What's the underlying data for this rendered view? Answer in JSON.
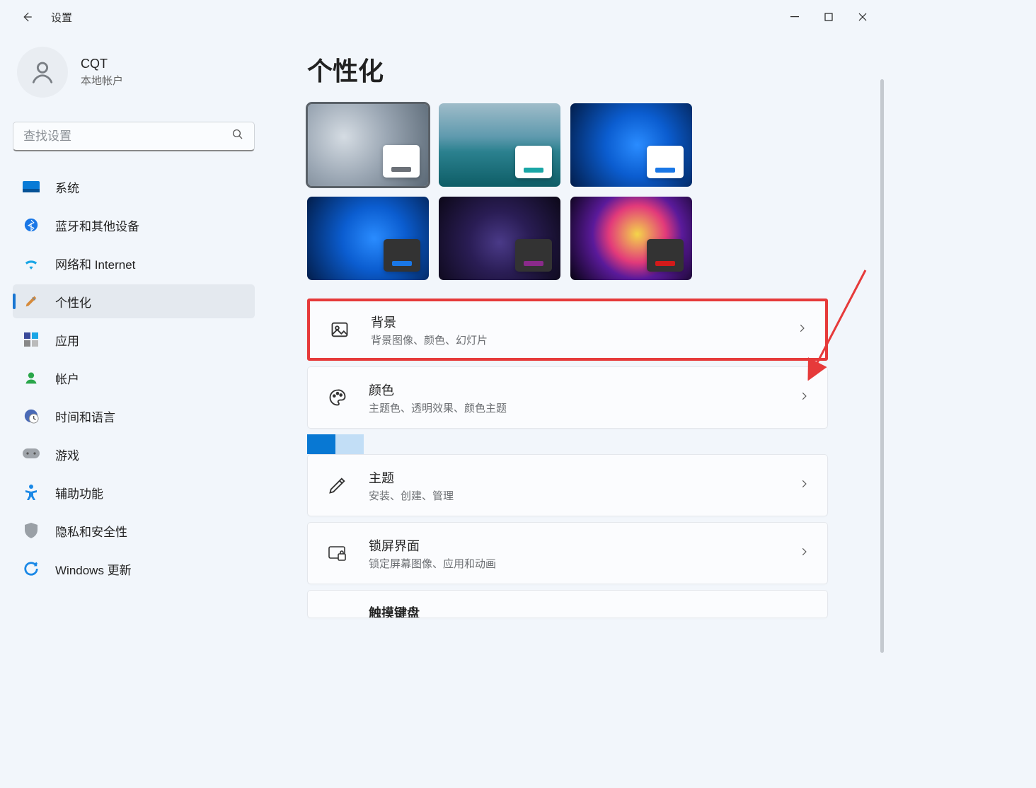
{
  "window": {
    "title": "设置"
  },
  "profile": {
    "name": "CQT",
    "account_type": "本地帐户"
  },
  "search": {
    "placeholder": "查找设置"
  },
  "sidebar": {
    "items": [
      {
        "label": "系统"
      },
      {
        "label": "蓝牙和其他设备"
      },
      {
        "label": "网络和 Internet"
      },
      {
        "label": "个性化"
      },
      {
        "label": "应用"
      },
      {
        "label": "帐户"
      },
      {
        "label": "时间和语言"
      },
      {
        "label": "游戏"
      },
      {
        "label": "辅助功能"
      },
      {
        "label": "隐私和安全性"
      },
      {
        "label": "Windows 更新"
      }
    ]
  },
  "main": {
    "page_title": "个性化",
    "theme_accents": [
      "#6c7178",
      "#1aa6a6",
      "#1a77e6",
      "#1a77e6",
      "#8a2a8a",
      "#d11a1a"
    ],
    "cards": [
      {
        "title": "背景",
        "desc": "背景图像、颜色、幻灯片"
      },
      {
        "title": "颜色",
        "desc": "主题色、透明效果、颜色主题"
      },
      {
        "title": "主题",
        "desc": "安装、创建、管理"
      },
      {
        "title": "锁屏界面",
        "desc": "锁定屏幕图像、应用和动画"
      },
      {
        "title": "触摸键盘",
        "desc": ""
      }
    ]
  }
}
